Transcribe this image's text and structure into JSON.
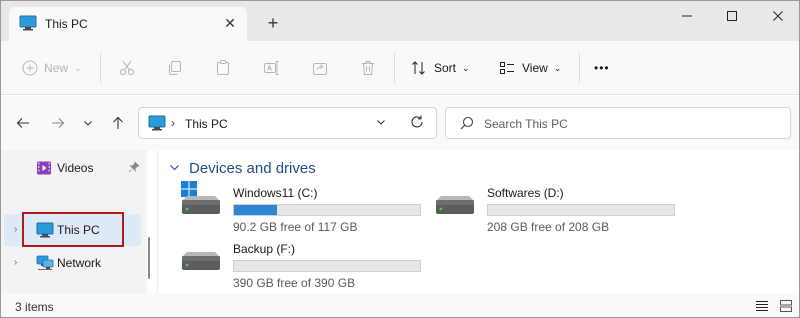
{
  "window": {
    "tab_title": "This PC",
    "tab_close": "✕",
    "new_tab": "+",
    "minimize": "—",
    "maximize": "☐",
    "close": "✕"
  },
  "toolbar": {
    "new_label": "New",
    "sort_label": "Sort",
    "view_label": "View",
    "more_label": "•••"
  },
  "address": {
    "location": "This PC",
    "search_placeholder": "Search This PC"
  },
  "sidebar": {
    "items": [
      {
        "label": "Videos",
        "icon": "videos-folder-icon",
        "pinned": true
      },
      {
        "label": "This PC",
        "icon": "this-pc-icon",
        "selected": true
      },
      {
        "label": "Network",
        "icon": "network-icon"
      }
    ]
  },
  "main": {
    "group_title": "Devices and drives",
    "drives": [
      {
        "name": "Windows11 (C:)",
        "free_text": "90.2 GB free of 117 GB",
        "used_fraction": 0.229,
        "system": true
      },
      {
        "name": "Softwares (D:)",
        "free_text": "208 GB free of 208 GB",
        "used_fraction": 0.0
      },
      {
        "name": "Backup (F:)",
        "free_text": "390 GB free of 390 GB",
        "used_fraction": 0.0
      }
    ]
  },
  "status": {
    "item_count": "3 items"
  },
  "colors": {
    "accent": "#2d86d3",
    "highlight_box": "#b11a1a",
    "group_header": "#1f4e8c",
    "selected_bg": "#dde9f6"
  }
}
